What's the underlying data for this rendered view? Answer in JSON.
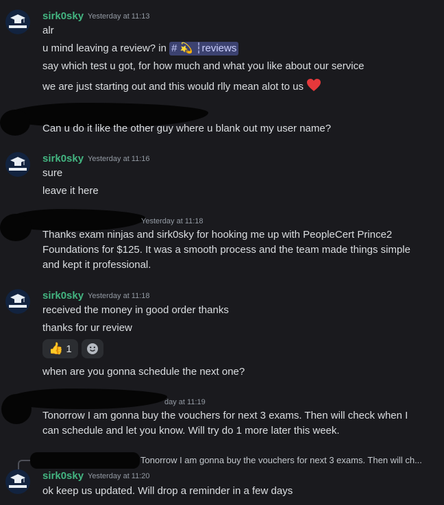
{
  "messages": [
    {
      "author": "sirk0sky",
      "time": "Yesterday at 11:13",
      "lines": [
        "alr"
      ],
      "review_prefix": "u mind leaving a review? in",
      "channel": "# 💫 ┆reviews",
      "line3": "say which test u got, for how much and what you like about our service",
      "line4": "we are just starting out and this would rlly mean alot to us"
    },
    {
      "line": "Can u do it like the other guy where u blank out my user name?"
    },
    {
      "author": "sirk0sky",
      "time": "Yesterday at 11:16",
      "line1": "sure",
      "line2": "leave it here"
    },
    {
      "time_partial": "Yesterday at 11:18",
      "text": "Thanks exam ninjas and sirk0sky for hooking me up with PeopleCert Prince2 Foundations for $125. It was a smooth process and the team made things simple and kept it professional."
    },
    {
      "author": "sirk0sky",
      "time": "Yesterday at 11:18",
      "line1": "received the money in good order thanks",
      "line2": "thanks for ur review",
      "reaction_emoji": "👍",
      "reaction_count": "1",
      "line3": "when are you gonna schedule the next one?"
    },
    {
      "time_partial": "day at 11:19",
      "text": "Tonorrow I am gonna buy the vouchers for next 3 exams. Then will check when I can schedule and let you know. Will try do 1 more later this week."
    },
    {
      "reply_preview": "Tonorrow I am gonna buy the vouchers for next 3 exams. Then will ch...",
      "author": "sirk0sky",
      "time": "Yesterday at 11:20",
      "line1": "ok keep us updated. Will drop a reminder in a few days"
    }
  ],
  "colors": {
    "background": "#1a1a1e",
    "username": "#43b581",
    "text": "#dbdee1",
    "timestamp": "#949ba4",
    "mention_bg": "#3c4270",
    "heart": "#e5383b"
  },
  "icons": {
    "avatar": "examninjas-logo-icon",
    "heart": "red-heart-icon",
    "add_reaction": "add-reaction-icon"
  }
}
